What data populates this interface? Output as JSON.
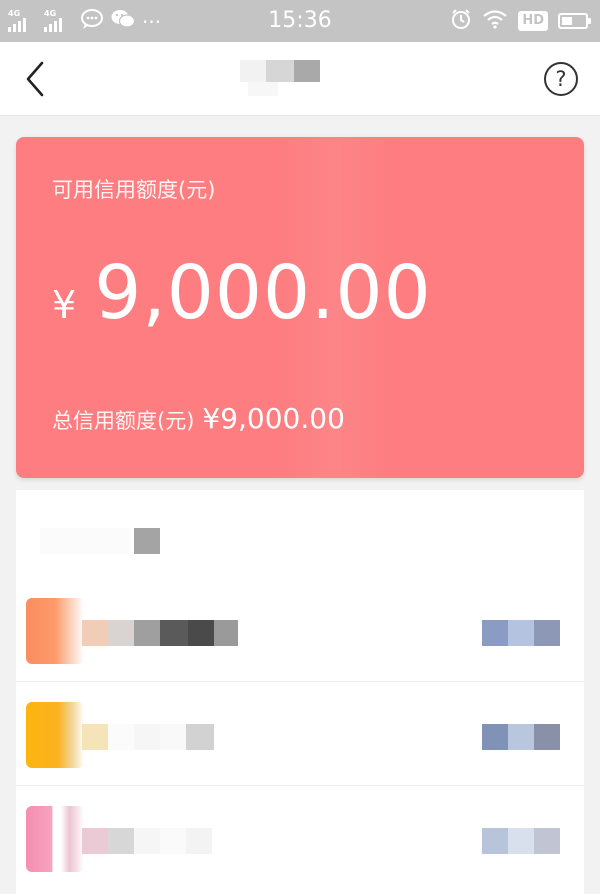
{
  "status_bar": {
    "network_1": "4G",
    "network_2": "4G",
    "time": "15:36",
    "hd_badge": "HD",
    "more_dots": "···"
  },
  "nav": {
    "title": "",
    "help_symbol": "?"
  },
  "credit_card": {
    "available_label": "可用信用额度(元)",
    "currency_symbol": "¥",
    "available_amount": "9,000.00",
    "total_label": "总信用额度(元)",
    "total_amount": "¥9,000.00"
  },
  "list": {
    "title": "",
    "items": [
      {
        "name": "",
        "value": ""
      },
      {
        "name": "",
        "value": ""
      },
      {
        "name": "",
        "value": ""
      }
    ]
  },
  "colors": {
    "card_background": "#fd7d80",
    "status_bar_background": "#c4c4c4"
  }
}
